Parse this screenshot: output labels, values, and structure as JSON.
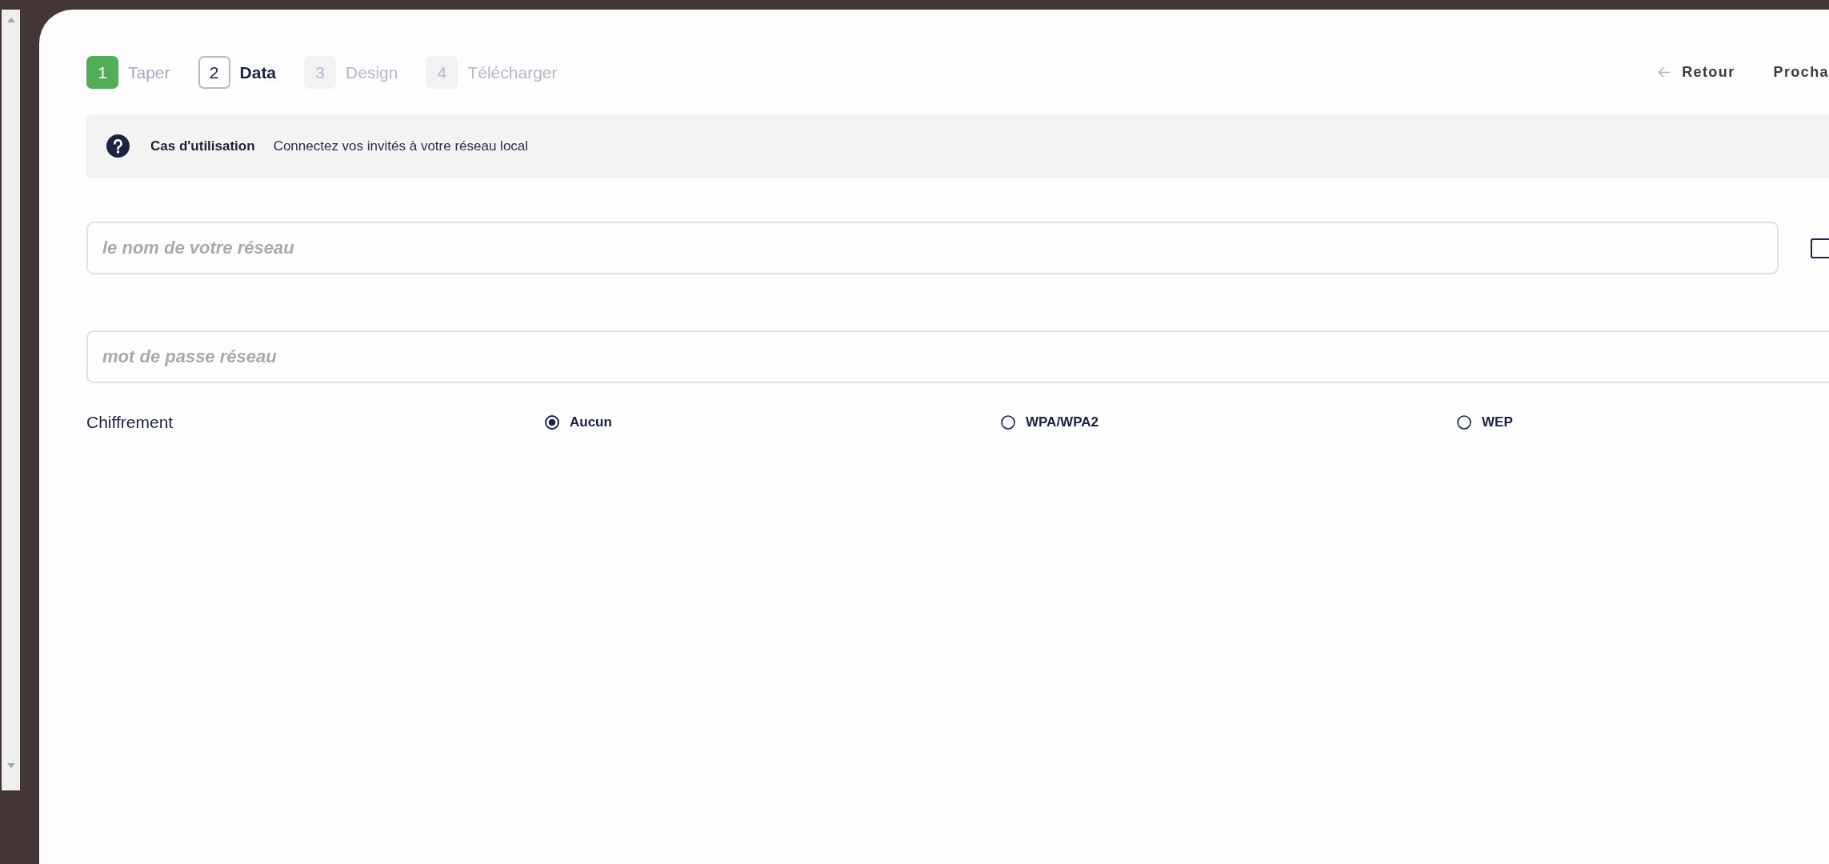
{
  "stepper": {
    "steps": [
      {
        "number": "1",
        "label": "Taper",
        "completed": true,
        "selected": false
      },
      {
        "number": "2",
        "label": "Data",
        "completed": false,
        "selected": true
      },
      {
        "number": "3",
        "label": "Design",
        "completed": false,
        "selected": false
      },
      {
        "number": "4",
        "label": "Télécharger",
        "completed": false,
        "selected": false
      }
    ]
  },
  "navigation": {
    "back_label": "Retour",
    "next_label": "Procha"
  },
  "info_bar": {
    "title": "Cas d'utilisation",
    "text": "Connectez vos invités à votre réseau local"
  },
  "network_name": {
    "placeholder": "le nom de votre réseau"
  },
  "checkbox": {
    "checked": false
  },
  "password": {
    "placeholder": "mot de passe réseau"
  },
  "encryption": {
    "label": "Chiffrement",
    "options": [
      {
        "label": "Aucun",
        "selected": true
      },
      {
        "label": "WPA/WPA2",
        "selected": false
      },
      {
        "label": "WEP",
        "selected": false
      }
    ]
  }
}
